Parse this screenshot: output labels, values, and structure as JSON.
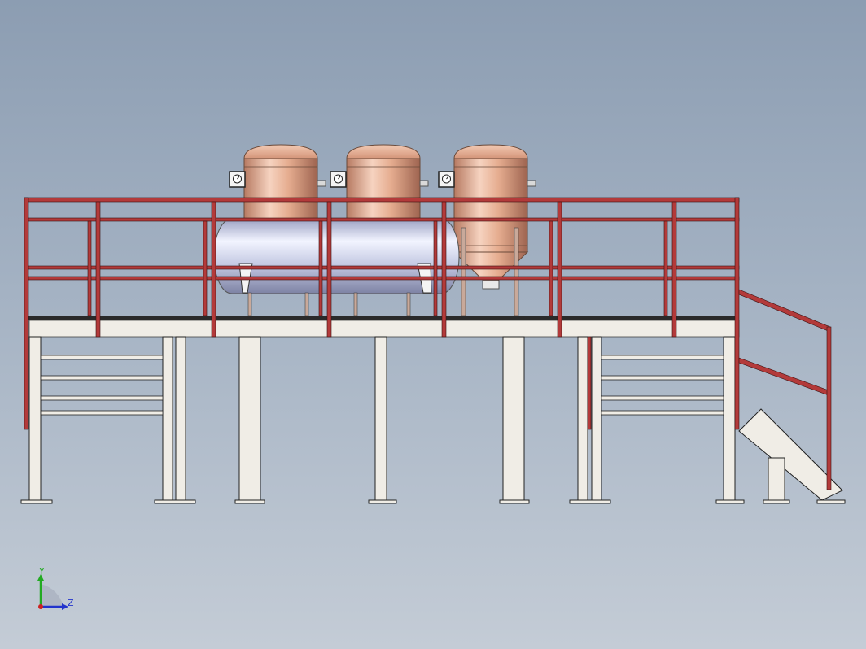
{
  "viewport": {
    "background_top": "#8c9db2",
    "background_bottom": "#c4ccd6"
  },
  "model": {
    "railing_color": "#b33a3a",
    "frame_color": "#f0ede6",
    "vessel_copper": "#e2a98d",
    "vessel_steel": "#c7cde6",
    "deck_color": "#2a2a2a"
  },
  "triad": {
    "y_label": "Y",
    "z_label": "Z",
    "y_color": "#22aa22",
    "z_color": "#2233cc",
    "x_color": "#cc2222"
  }
}
